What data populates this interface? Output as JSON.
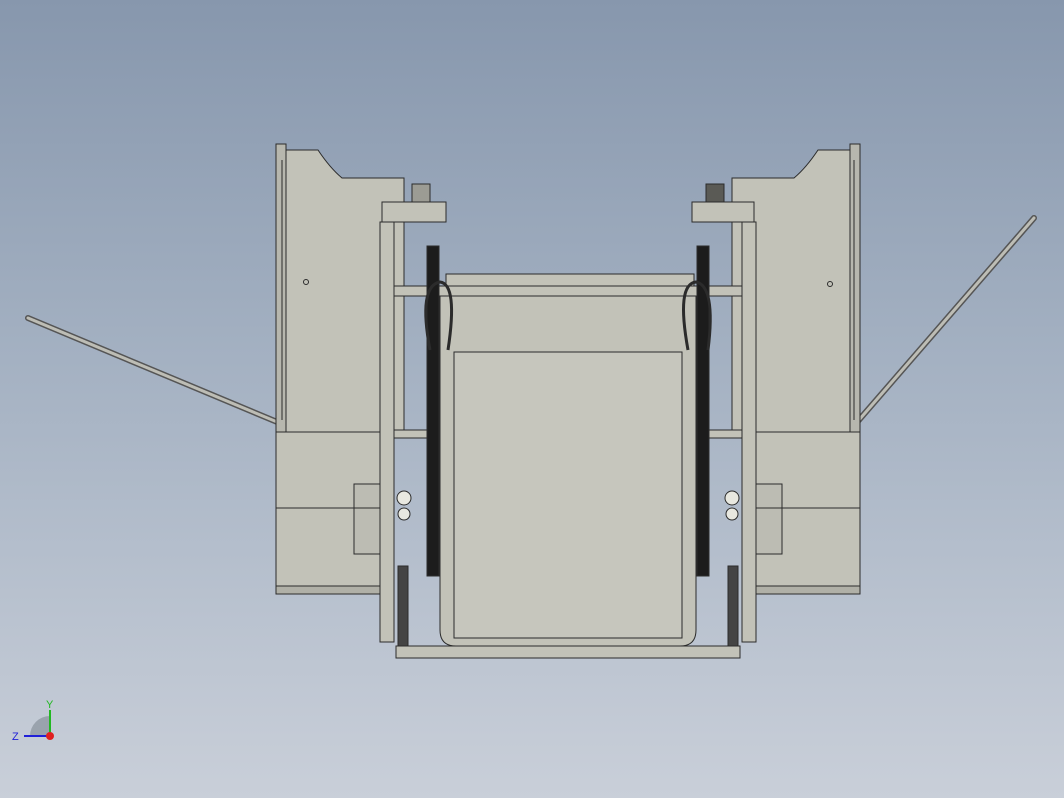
{
  "viewport": {
    "background_top": "#8797ad",
    "background_bottom": "#c9cfd9"
  },
  "model": {
    "part_color": "#c2c2b8",
    "part_dark": "#a9a9a0",
    "edge_color": "#2b2b2b",
    "chain_color": "#1c1c1c"
  },
  "triad": {
    "x_label": "",
    "y_label": "Y",
    "z_label": "Z",
    "x_color": "#e02020",
    "y_color": "#22b822",
    "z_color": "#2020d8"
  }
}
